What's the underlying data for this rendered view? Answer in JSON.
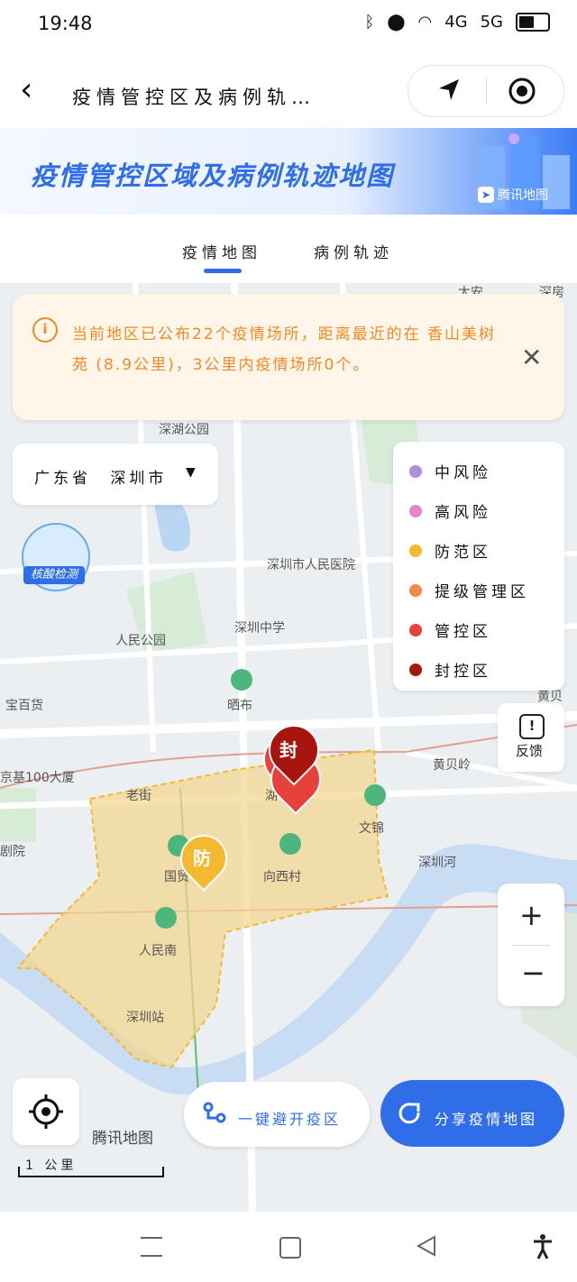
{
  "status_bar": {
    "time": "19:48",
    "net1": "4G",
    "net2": "5G"
  },
  "header": {
    "back_label": "‹",
    "title": "疫情管控区及病例轨…"
  },
  "banner": {
    "title": "疫情管控区域及病例轨迹地图",
    "brand": "腾讯地图"
  },
  "tabs": [
    {
      "label": "疫情地图",
      "active": true
    },
    {
      "label": "病例轨迹",
      "active": false
    }
  ],
  "notice": {
    "icon": "i",
    "text": "当前地区已公布22个疫情场所，距离最近的在 香山美树苑 (8.9公里)，3公里内疫情场所0个。",
    "close": "✕"
  },
  "region": {
    "province": "广东省",
    "city": "深圳市"
  },
  "legend": [
    {
      "label": "中风险",
      "color": "#b38ee0"
    },
    {
      "label": "高风险",
      "color": "#e085d4"
    },
    {
      "label": "防范区",
      "color": "#f5b931"
    },
    {
      "label": "提级管理区",
      "color": "#f08a4b"
    },
    {
      "label": "管控区",
      "color": "#e8403a"
    },
    {
      "label": "封控区",
      "color": "#a8150f"
    }
  ],
  "map": {
    "labels": [
      "太安",
      "深房",
      "深湖公园",
      "深圳市人民医院",
      "深圳中学",
      "人民公园",
      "晒布",
      "宝百货",
      "黄贝岭",
      "京基100大厦",
      "老街",
      "湖",
      "文锦",
      "国贸",
      "向西村",
      "深圳河",
      "人民南",
      "深圳站",
      "剧院",
      "黄贝"
    ],
    "markers": {
      "sealed": "封",
      "prevention": "防"
    },
    "nucleic_badge": "核酸检测"
  },
  "controls": {
    "feedback": "反馈",
    "zoom_in": "+",
    "zoom_out": "−",
    "logo": "腾讯地图",
    "scale": "1 公里"
  },
  "actions": {
    "avoid": "一键避开疫区",
    "share": "分享疫情地图"
  }
}
